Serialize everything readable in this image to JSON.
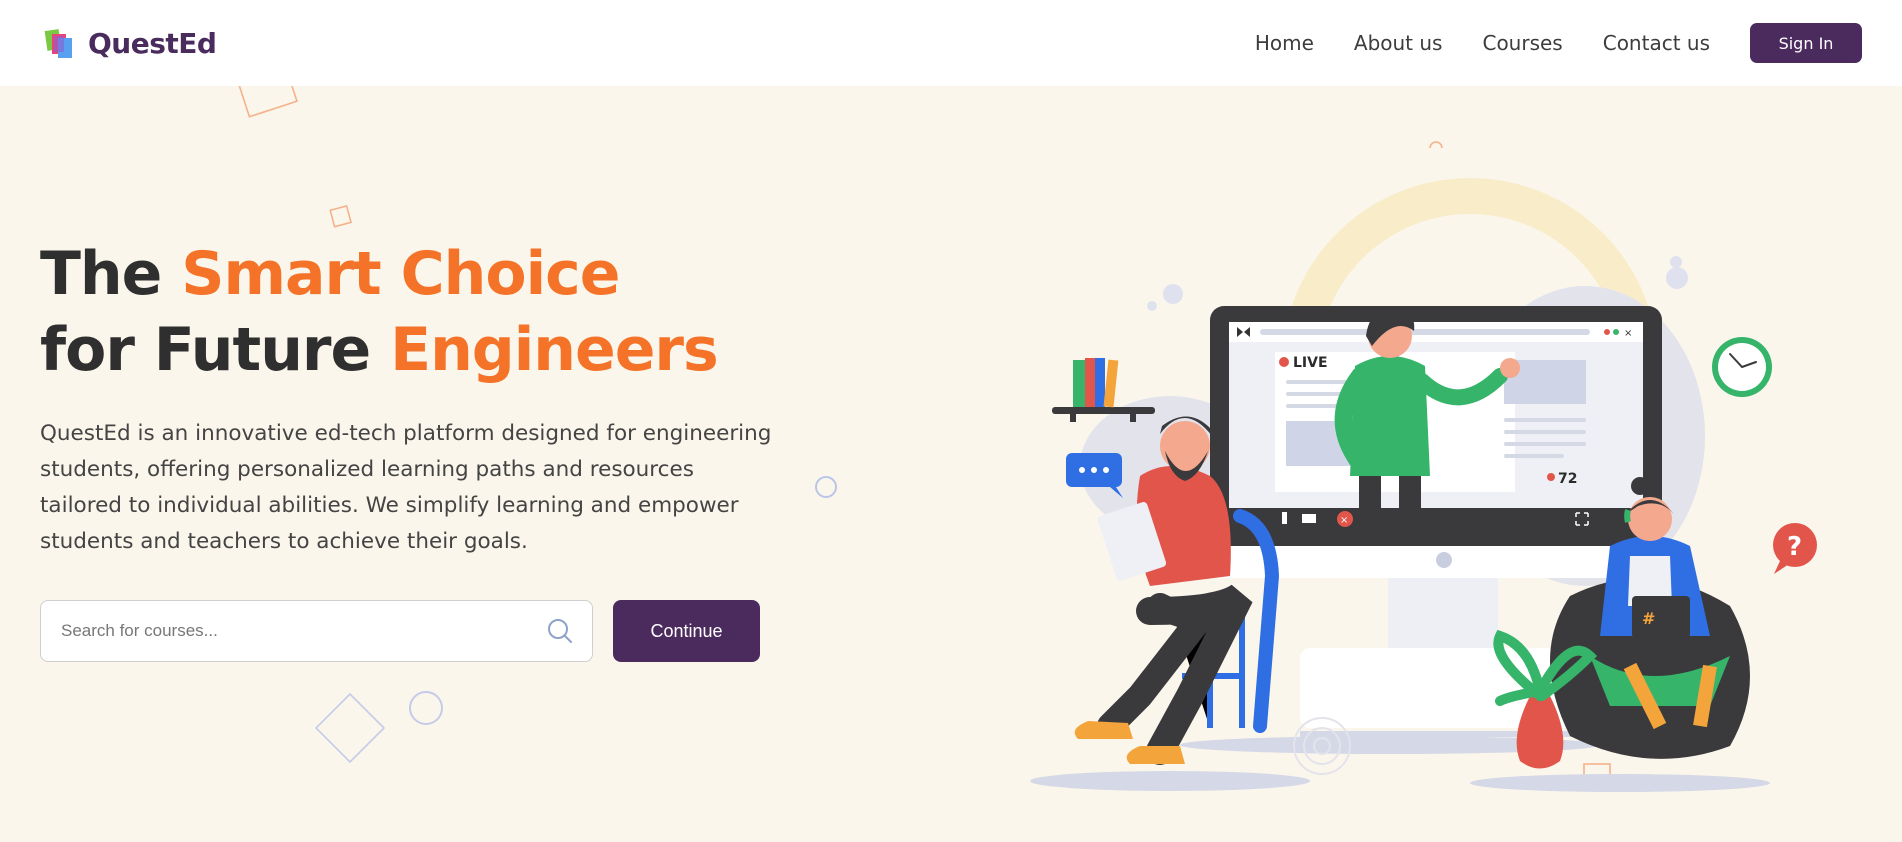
{
  "brand": {
    "name": "QuestEd",
    "logo_icon": "books-logo-icon"
  },
  "nav": {
    "links": [
      {
        "label": "Home"
      },
      {
        "label": "About us"
      },
      {
        "label": "Courses"
      },
      {
        "label": "Contact us"
      }
    ],
    "signin_label": "Sign In"
  },
  "hero": {
    "headline_line1_plain": "The ",
    "headline_line1_accent": "Smart Choice",
    "headline_line2_plain": "for Future ",
    "headline_line2_accent": "Engineers",
    "description": "QuestEd is an innovative ed-tech platform designed for engineering students, offering personalized learning paths and resources tailored to individual abilities. We simplify learning and empower students and teachers to achieve their goals.",
    "search_placeholder": "Search for courses...",
    "search_value": "",
    "continue_label": "Continue"
  },
  "illustration": {
    "live_label": "LIVE",
    "viewer_count": "72"
  },
  "colors": {
    "brand_purple": "#4b2a5e",
    "accent_orange": "#f57328",
    "background": "#fbf6ec"
  }
}
